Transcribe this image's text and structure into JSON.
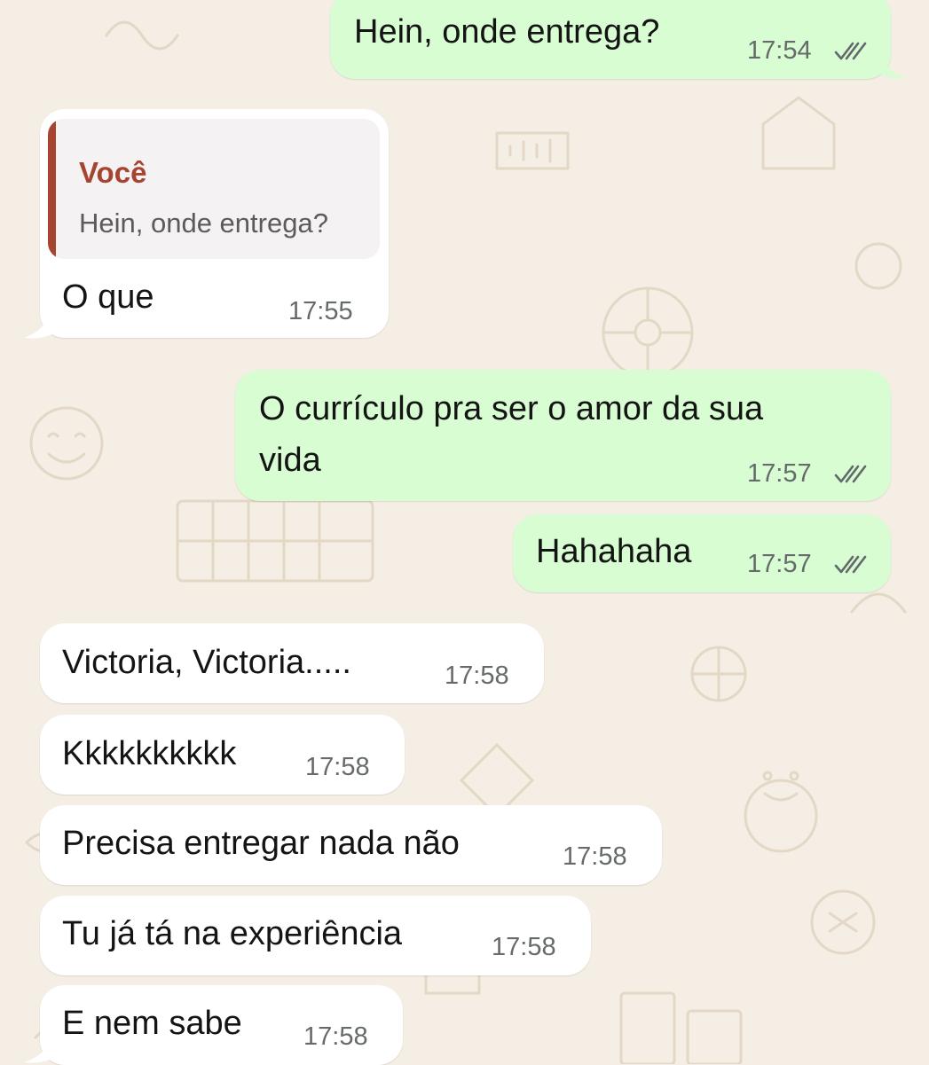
{
  "theme": {
    "wallpaper": "#f4eee4",
    "outgoing_bubble": "#d8fdd2",
    "incoming_bubble": "#ffffff",
    "quote_accent": "#a6442f",
    "tick_icon": "double-check-icon"
  },
  "messages": [
    {
      "direction": "outgoing",
      "text": "Hein, onde entrega?",
      "time": "17:54",
      "status": "read"
    },
    {
      "direction": "incoming",
      "reply_to": {
        "author": "Você",
        "text": "Hein, onde entrega?"
      },
      "text": "O que",
      "time": "17:55"
    },
    {
      "direction": "outgoing",
      "text_line1": "O currículo pra ser o amor da sua",
      "text_line2": "vida",
      "time": "17:57",
      "status": "read"
    },
    {
      "direction": "outgoing",
      "text": "Hahahaha",
      "time": "17:57",
      "status": "read"
    },
    {
      "direction": "incoming",
      "text": "Victoria, Victoria.....",
      "time": "17:58"
    },
    {
      "direction": "incoming",
      "text": "Kkkkkkkkkk",
      "time": "17:58"
    },
    {
      "direction": "incoming",
      "text": "Precisa entregar nada não",
      "time": "17:58"
    },
    {
      "direction": "incoming",
      "text": "Tu já tá na experiência",
      "time": "17:58"
    },
    {
      "direction": "incoming",
      "text": "E nem sabe",
      "time": "17:58"
    }
  ]
}
